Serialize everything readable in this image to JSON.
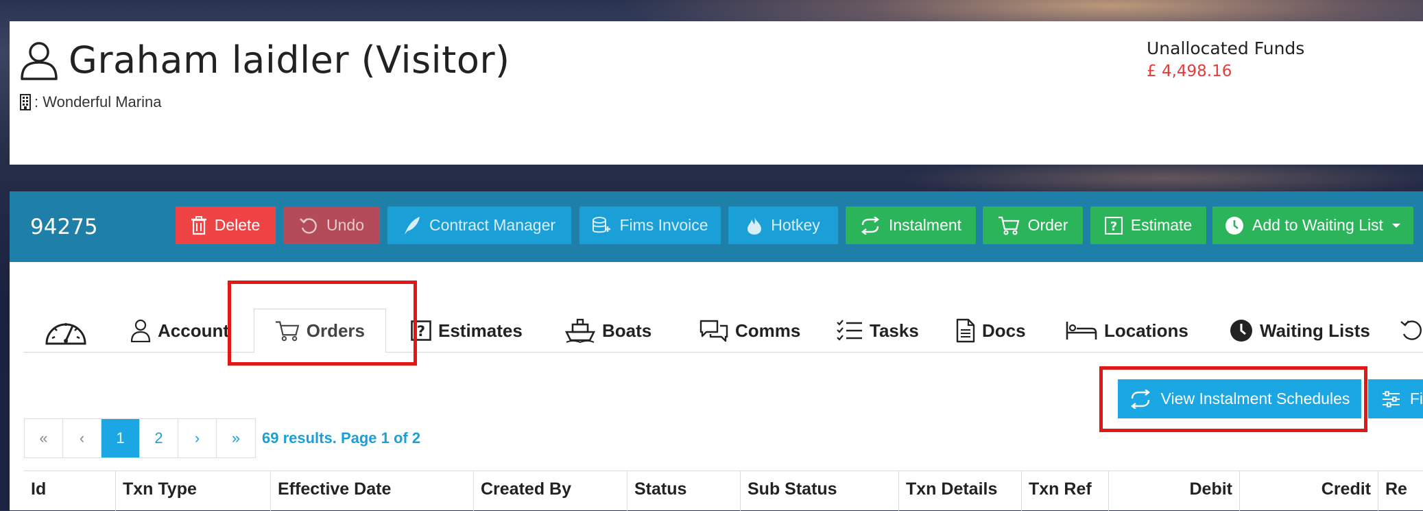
{
  "header": {
    "title": "Graham laidler (Visitor)",
    "marina": ": Wonderful Marina",
    "funds_label": "Unallocated Funds",
    "funds_value": "£ 4,498.16"
  },
  "toolbar": {
    "record_id": "94275",
    "buttons": {
      "delete": "Delete",
      "undo": "Undo",
      "contract_manager": "Contract Manager",
      "fims_invoice": "Fims Invoice",
      "hotkey": "Hotkey",
      "instalment": "Instalment",
      "order": "Order",
      "estimate": "Estimate",
      "add_waiting": "Add to Waiting List"
    }
  },
  "tabs": {
    "account": "Account",
    "orders": "Orders",
    "estimates": "Estimates",
    "boats": "Boats",
    "comms": "Comms",
    "tasks": "Tasks",
    "docs": "Docs",
    "locations": "Locations",
    "waiting_lists": "Waiting Lists"
  },
  "actions": {
    "view_schedules": "View Instalment Schedules",
    "filter": "Fi"
  },
  "pager": {
    "first": "«",
    "prev": "‹",
    "pages": [
      "1",
      "2"
    ],
    "next": "›",
    "last": "»",
    "results": "69 results. Page 1 of 2"
  },
  "table": {
    "columns": [
      "Id",
      "Txn Type",
      "Effective Date",
      "Created By",
      "Status",
      "Sub Status",
      "Txn Details",
      "Txn Ref",
      "Debit",
      "Credit",
      "Re"
    ]
  },
  "colors": {
    "toolbar": "#1e7fa8",
    "danger": "#ef4446",
    "info": "#1a9fd6",
    "success": "#2cb45a",
    "accent": "#1aa7e3",
    "funds": "#e53b3b",
    "highlight": "#e01818"
  }
}
